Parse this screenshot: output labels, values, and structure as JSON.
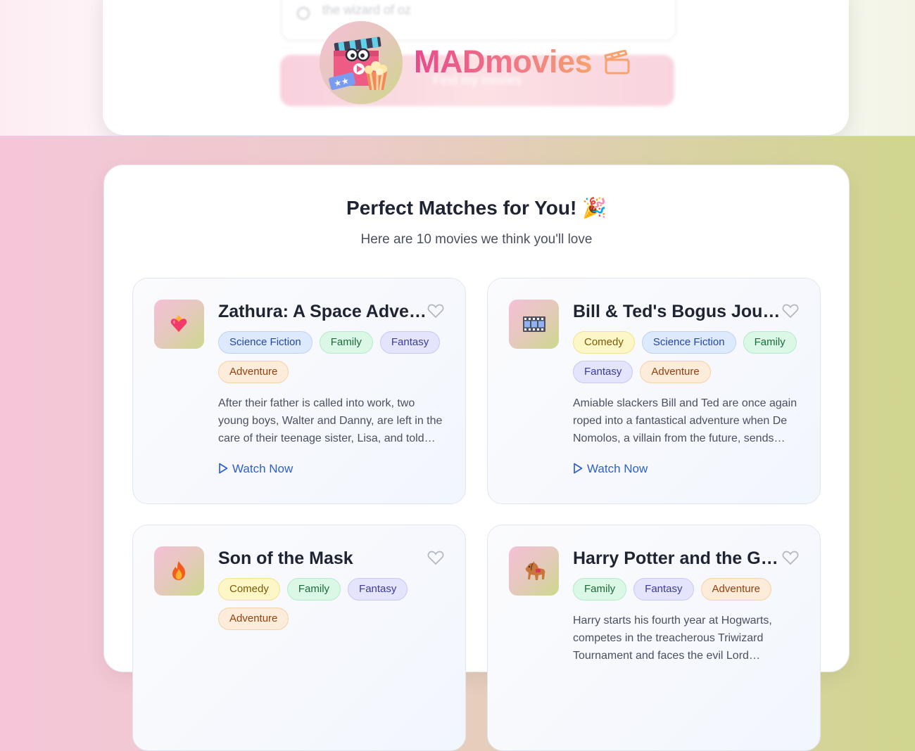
{
  "header": {
    "search_placeholder": "the wizard of oz",
    "search_button_label": "Find my movies",
    "brand_name": "MADmovies",
    "logo_icon": "clapperboard-popcorn-mascot",
    "brand_icon": "clapperboard-icon"
  },
  "results": {
    "title": "Perfect Matches for You! 🎉",
    "subtitle": "Here are 10 movies we think you'll love",
    "watch_label": "Watch Now",
    "movies": [
      {
        "thumb_icon": "heart-on-fire-emoji",
        "title": "Zathura: A Space Adventure",
        "genres": [
          "Science Fiction",
          "Family",
          "Fantasy",
          "Adventure"
        ],
        "description": "After their father is called into work, two young boys, Walter and Danny, are left in the care of their teenage sister, Lisa, and told they must stay inside."
      },
      {
        "thumb_icon": "film-frames-emoji",
        "title": "Bill & Ted's Bogus Journey",
        "genres": [
          "Comedy",
          "Science Fiction",
          "Family",
          "Fantasy",
          "Adventure"
        ],
        "description": "Amiable slackers Bill and Ted are once again roped into a fantastical adventure when De Nomolos, a villain from the future, sends androids to kill them."
      },
      {
        "thumb_icon": "fire-emoji",
        "title": "Son of the Mask",
        "genres": [
          "Comedy",
          "Family",
          "Fantasy",
          "Adventure"
        ],
        "description": ""
      },
      {
        "thumb_icon": "horse-emoji",
        "title": "Harry Potter and the Goblet of Fire",
        "genres": [
          "Family",
          "Fantasy",
          "Adventure"
        ],
        "description": "Harry starts his fourth year at Hogwarts, competes in the treacherous Triwizard Tournament and faces the evil Lord Voldemort."
      }
    ]
  },
  "colors": {
    "brand_gradient_start": "#e64a8c",
    "brand_gradient_end": "#f6a36f",
    "link_blue": "#2c5fcf",
    "title_dark": "#1f2433"
  }
}
